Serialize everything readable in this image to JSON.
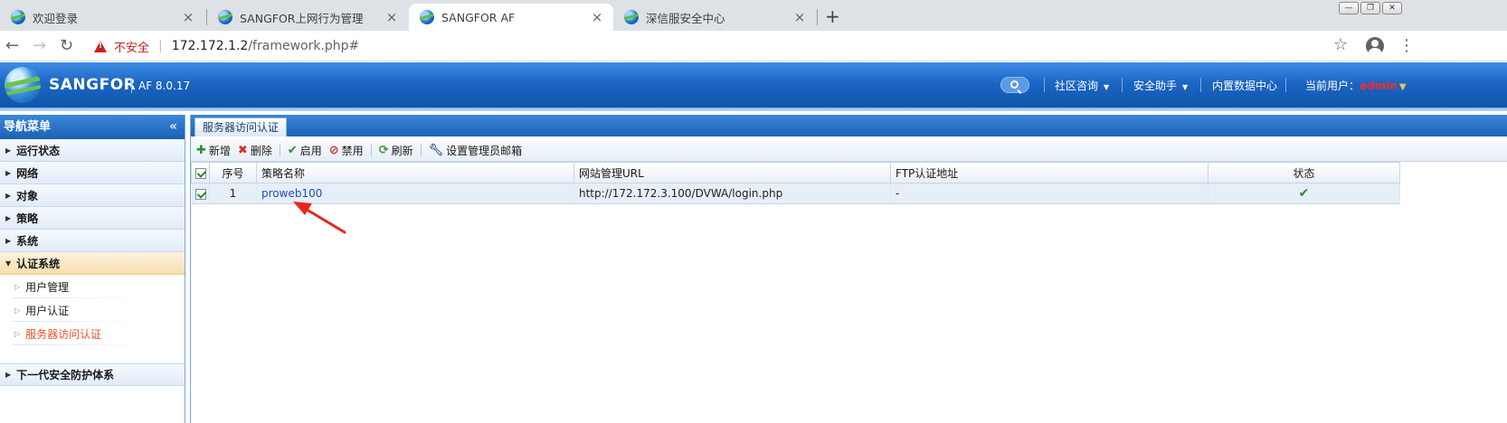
{
  "browser": {
    "tabs": [
      {
        "title": "欢迎登录"
      },
      {
        "title": "SANGFOR上网行为管理"
      },
      {
        "title": "SANGFOR AF"
      },
      {
        "title": "深信服安全中心"
      }
    ],
    "security_label": "不安全",
    "url_host": "172.172.1.2",
    "url_path": "/framework.php#"
  },
  "app": {
    "brand": "SANGFOR",
    "version": "AF 8.0.17",
    "header_menu": {
      "community": "社区咨询",
      "assistant": "安全助手",
      "datacenter": "内置数据中心",
      "current_user_label": "当前用户：",
      "current_user": "admin"
    }
  },
  "sidebar": {
    "title": "导航菜单",
    "items": [
      {
        "label": "运行状态"
      },
      {
        "label": "网络"
      },
      {
        "label": "对象"
      },
      {
        "label": "策略"
      },
      {
        "label": "系统"
      },
      {
        "label": "认证系统"
      }
    ],
    "sub_items": [
      {
        "label": "用户管理"
      },
      {
        "label": "用户认证"
      },
      {
        "label": "服务器访问认证"
      }
    ],
    "bottom_item": "下一代安全防护体系"
  },
  "main": {
    "tab_label": "服务器访问认证",
    "toolbar": {
      "add": "新增",
      "delete": "删除",
      "enable": "启用",
      "disable": "禁用",
      "refresh": "刷新",
      "admin_email": "设置管理员邮箱"
    },
    "table": {
      "headers": {
        "index": "序号",
        "name": "策略名称",
        "url": "网站管理URL",
        "ftp": "FTP认证地址",
        "status": "状态"
      },
      "rows": [
        {
          "index": "1",
          "name": "proweb100",
          "url": "http://172.172.3.100/DVWA/login.php",
          "ftp": "-",
          "status": "enabled"
        }
      ]
    }
  },
  "colors": {
    "header_blue": "#1c66c3",
    "active_nav": "#e8522b",
    "user_name": "#ff2a2a",
    "annotation_arrow": "#e8261e"
  }
}
